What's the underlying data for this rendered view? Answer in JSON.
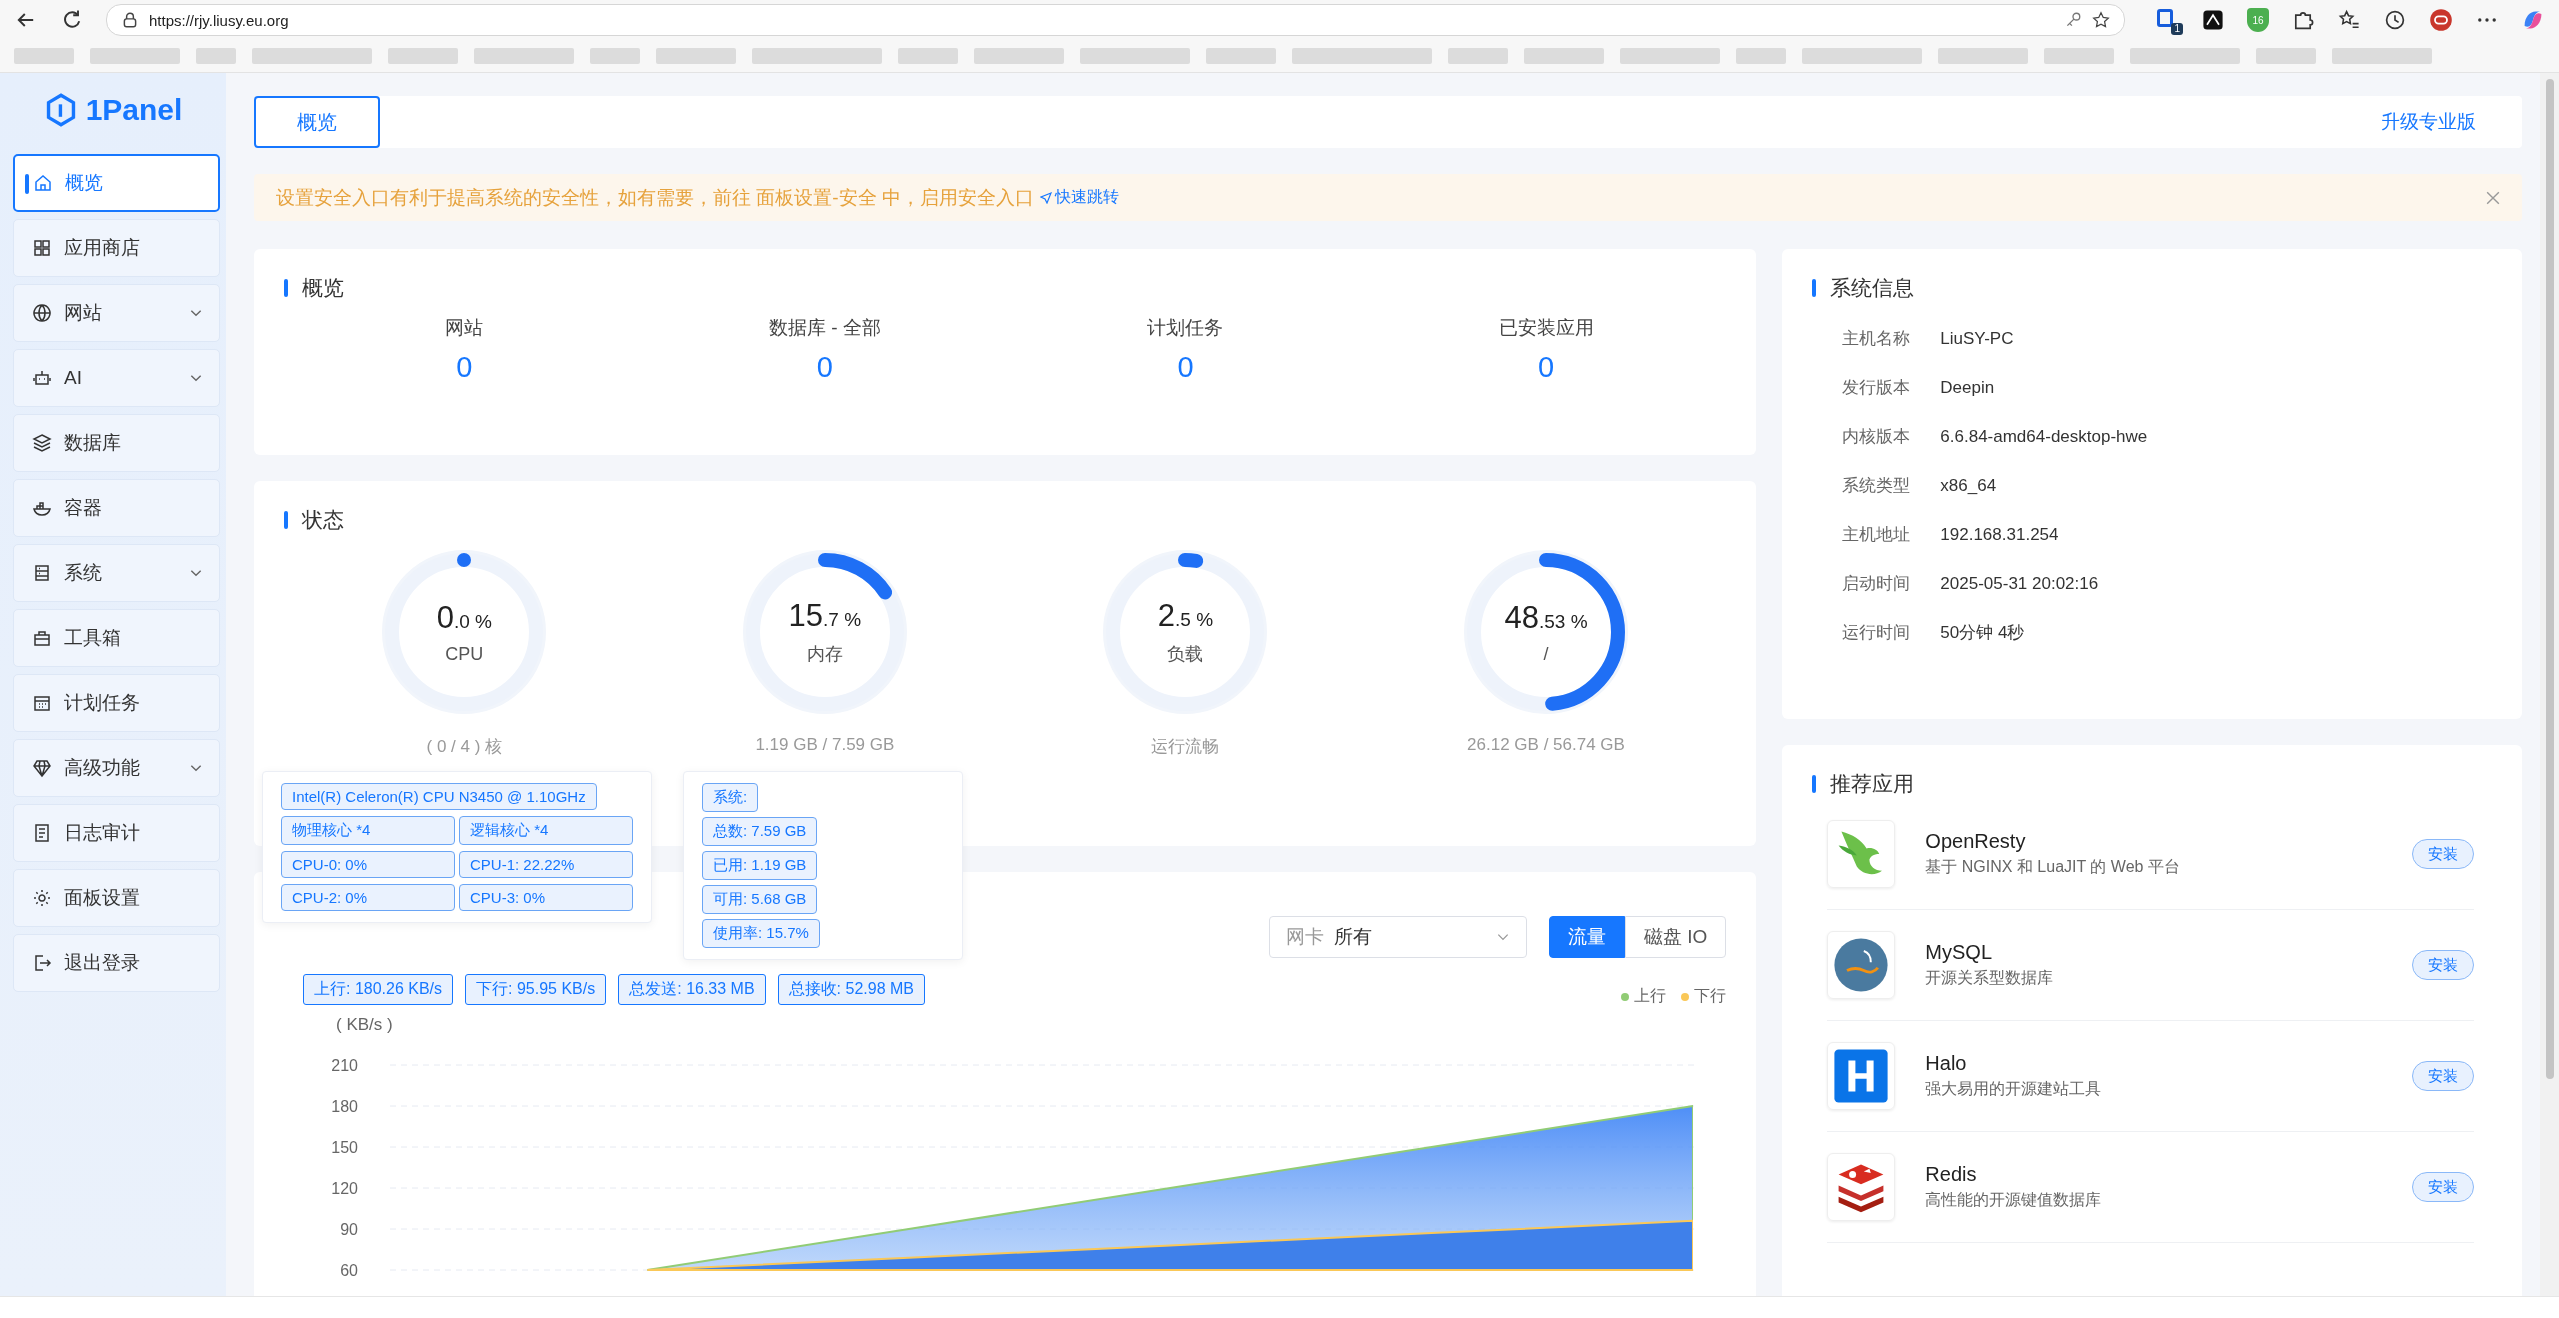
{
  "browser": {
    "url": "https://rjy.liusy.eu.org",
    "extension_badges": [
      "1",
      "16"
    ]
  },
  "sidebar": {
    "logo": "1Panel",
    "items": [
      {
        "label": "概览",
        "selected": true,
        "expandable": false
      },
      {
        "label": "应用商店",
        "selected": false,
        "expandable": false
      },
      {
        "label": "网站",
        "selected": false,
        "expandable": true
      },
      {
        "label": "AI",
        "selected": false,
        "expandable": true
      },
      {
        "label": "数据库",
        "selected": false,
        "expandable": false
      },
      {
        "label": "容器",
        "selected": false,
        "expandable": false
      },
      {
        "label": "系统",
        "selected": false,
        "expandable": true
      },
      {
        "label": "工具箱",
        "selected": false,
        "expandable": false
      },
      {
        "label": "计划任务",
        "selected": false,
        "expandable": false
      },
      {
        "label": "高级功能",
        "selected": false,
        "expandable": true
      },
      {
        "label": "日志审计",
        "selected": false,
        "expandable": false
      },
      {
        "label": "面板设置",
        "selected": false,
        "expandable": false
      },
      {
        "label": "退出登录",
        "selected": false,
        "expandable": false
      }
    ]
  },
  "header": {
    "tabs": [
      {
        "label": "概览",
        "selected": true
      }
    ],
    "upgrade_link": "升级专业版"
  },
  "alert": {
    "text": "设置安全入口有利于提高系统的安全性，如有需要，前往 面板设置-安全 中，启用安全入口",
    "link": "快速跳转"
  },
  "overview": {
    "title": "概览",
    "stats": [
      {
        "label": "网站",
        "value": "0"
      },
      {
        "label": "数据库 - 全部",
        "value": "0"
      },
      {
        "label": "计划任务",
        "value": "0"
      },
      {
        "label": "已安装应用",
        "value": "0"
      }
    ]
  },
  "status": {
    "title": "状态",
    "gauges": [
      {
        "integer": "0",
        "fraction": ".0",
        "unit": "%",
        "name": "CPU",
        "level": 0,
        "detail": "( 0 / 4 ) 核"
      },
      {
        "integer": "15",
        "fraction": ".7",
        "unit": "%",
        "name": "内存",
        "level": 0.157,
        "detail": "1.19 GB / 7.59 GB"
      },
      {
        "integer": "2",
        "fraction": ".5",
        "unit": "%",
        "name": "负载",
        "level": 0.025,
        "detail": "运行流畅"
      },
      {
        "integer": "48",
        "fraction": ".53",
        "unit": "%",
        "name": "/",
        "level": 0.4853,
        "detail": "26.12 GB / 56.74 GB"
      }
    ]
  },
  "popovers": [
    {
      "rows": [
        [
          "Intel(R) Celeron(R) CPU N3450 @ 1.10GHz"
        ],
        [
          "物理核心 *4",
          "逻辑核心 *4"
        ],
        [
          "CPU-0: 0%",
          "CPU-1: 22.22%"
        ],
        [
          "CPU-2: 0%",
          "CPU-3: 0%"
        ]
      ]
    },
    {
      "rows": [
        [
          "系统:"
        ],
        [
          "总数: 7.59 GB"
        ],
        [
          "已用: 1.19 GB"
        ],
        [
          "可用: 5.68 GB"
        ],
        [
          "使用率: 15.7%"
        ]
      ]
    }
  ],
  "monitor": {
    "nic_select": {
      "prefix": "网卡",
      "value": "所有"
    },
    "toggles": [
      {
        "label": "流量",
        "selected": true
      },
      {
        "label": "磁盘 IO",
        "selected": false
      }
    ],
    "tags": [
      "上行: 180.26 KB/s",
      "下行: 95.95 KB/s",
      "总发送: 16.33 MB",
      "总接收: 52.98 MB"
    ],
    "chart_data": {
      "type": "area",
      "ylabel": "( KB/s )",
      "ylim": [
        60,
        210
      ],
      "yticks": [
        60,
        90,
        120,
        150,
        180,
        210
      ],
      "grid": true,
      "series": [
        {
          "name": "上行",
          "color": "#91cc75",
          "values": [
            null,
            60,
            90,
            120,
            150,
            180
          ]
        },
        {
          "name": "下行",
          "color": "#fac858",
          "values": [
            null,
            60,
            69,
            78,
            87,
            96
          ]
        }
      ]
    }
  },
  "system_info": {
    "title": "系统信息",
    "rows": [
      {
        "label": "主机名称",
        "value": "LiuSY-PC"
      },
      {
        "label": "发行版本",
        "value": "Deepin"
      },
      {
        "label": "内核版本",
        "value": "6.6.84-amd64-desktop-hwe"
      },
      {
        "label": "系统类型",
        "value": "x86_64"
      },
      {
        "label": "主机地址",
        "value": "192.168.31.254"
      },
      {
        "label": "启动时间",
        "value": "2025-05-31 20:02:16"
      },
      {
        "label": "运行时间",
        "value": "50分钟 4秒"
      }
    ]
  },
  "recommended": {
    "title": "推荐应用",
    "apps": [
      {
        "name": "OpenResty",
        "description": "基于 NGINX 和 LuaJIT 的 Web 平台",
        "button": "安装"
      },
      {
        "name": "MySQL",
        "description": "开源关系型数据库",
        "button": "安装"
      },
      {
        "name": "Halo",
        "description": "强大易用的开源建站工具",
        "button": "安装"
      },
      {
        "name": "Redis",
        "description": "高性能的开源键值数据库",
        "button": "安装"
      }
    ]
  }
}
